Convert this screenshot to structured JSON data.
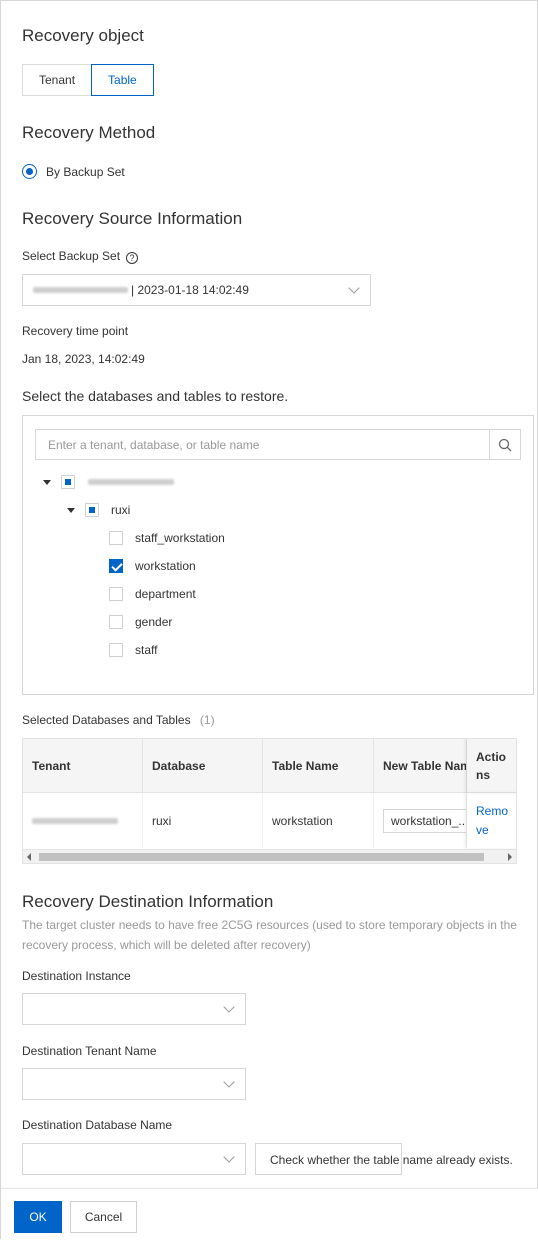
{
  "recovery_object": {
    "heading": "Recovery object",
    "options": [
      "Tenant",
      "Table"
    ],
    "selected": "Table"
  },
  "recovery_method": {
    "heading": "Recovery Method",
    "option": "By Backup Set"
  },
  "source": {
    "heading": "Recovery Source Information",
    "backup_set_label": "Select Backup Set",
    "backup_set_value": "| 2023-01-18 14:02:49",
    "time_point_label": "Recovery time point",
    "time_point_value": "Jan 18, 2023, 14:02:49",
    "select_prompt": "Select the databases and tables to restore."
  },
  "tree": {
    "search_placeholder": "Enter a tenant, database, or table name",
    "database": "ruxi",
    "tables": [
      "staff_workstation",
      "workstation",
      "department",
      "gender",
      "staff"
    ],
    "checked": [
      "workstation"
    ]
  },
  "selected_table": {
    "label": "Selected Databases and Tables",
    "count": "(1)",
    "headers": [
      "Tenant",
      "Database",
      "Table Name",
      "New Table Nam",
      "Actio ns"
    ],
    "rows": [
      {
        "database": "ruxi",
        "table_name": "workstation",
        "new_table_name": "workstation_...",
        "action": "Remo ve"
      }
    ]
  },
  "destination": {
    "heading": "Recovery Destination Information",
    "note": "The target cluster needs to have free 2C5G resources (used to store temporary objects in the recovery process, which will be deleted after recovery)",
    "instance_label": "Destination Instance",
    "tenant_label": "Destination Tenant Name",
    "database_label": "Destination Database Name",
    "check_button": "Check whether the table name already exists."
  },
  "footer": {
    "ok": "OK",
    "cancel": "Cancel"
  },
  "colors": {
    "accent": "#0064c8",
    "border": "#d6d6d6"
  }
}
